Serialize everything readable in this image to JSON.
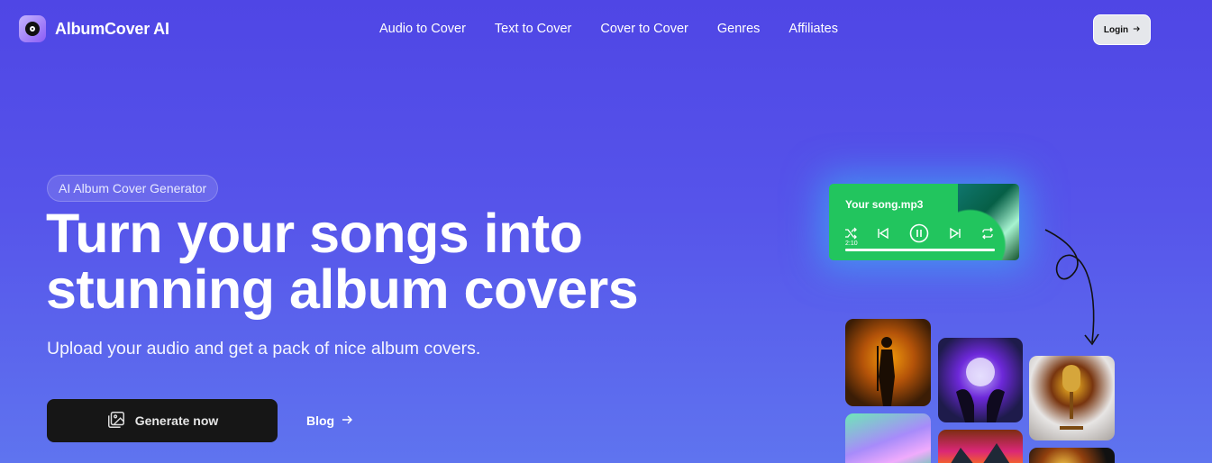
{
  "brand": {
    "name": "AlbumCover AI"
  },
  "nav": {
    "items": [
      "Audio to Cover",
      "Text to Cover",
      "Cover to Cover",
      "Genres",
      "Affiliates"
    ]
  },
  "header": {
    "login_label": "Login"
  },
  "hero": {
    "badge": "AI Album Cover Generator",
    "title_line1": "Turn your songs into",
    "title_line2": "stunning album covers",
    "subtitle": "Upload your audio and get a pack of nice album covers.",
    "cta_label": "Generate now",
    "blog_label": "Blog"
  },
  "player": {
    "song": "Your song.mp3",
    "time": "2:10",
    "progress": 1.0
  },
  "colors": {
    "background": "#5654ea",
    "player": "#22c55e",
    "cta": "#161616"
  }
}
